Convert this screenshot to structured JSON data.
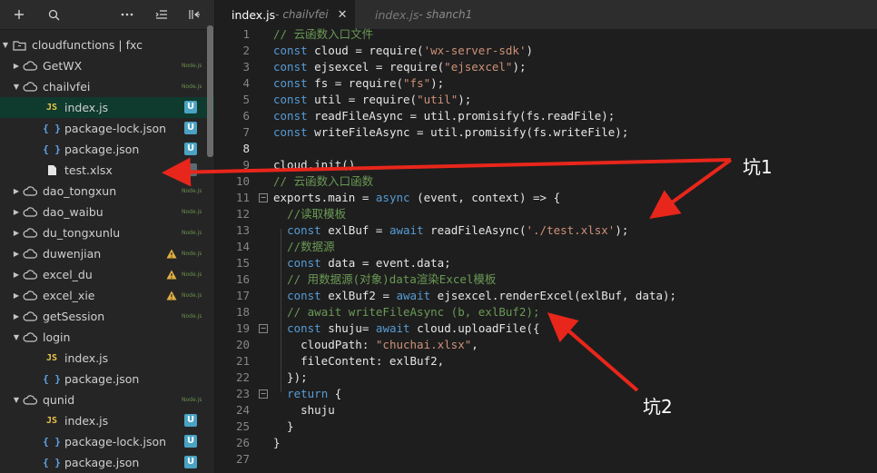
{
  "sidebar": {
    "toolbar_icons": [
      "plus-icon",
      "search-icon",
      "more-icon",
      "collapse-icon",
      "split-icon"
    ],
    "tree": [
      {
        "label": "cloudfunctions | fxc",
        "level": 0,
        "kind": "folder",
        "expanded": true,
        "root": true
      },
      {
        "label": "GetWX",
        "level": 1,
        "kind": "cloud",
        "expanded": false,
        "tag": "Node.js"
      },
      {
        "label": "chailvfei",
        "level": 1,
        "kind": "cloud",
        "expanded": true,
        "tag": "Node.js"
      },
      {
        "label": "index.js",
        "level": 2,
        "kind": "js",
        "badge": "U",
        "active": true
      },
      {
        "label": "package-lock.json",
        "level": 2,
        "kind": "json",
        "badge": "U"
      },
      {
        "label": "package.json",
        "level": 2,
        "kind": "json",
        "badge": "U"
      },
      {
        "label": "test.xlsx",
        "level": 2,
        "kind": "file",
        "badge": ""
      },
      {
        "label": "dao_tongxun",
        "level": 1,
        "kind": "cloud",
        "expanded": false,
        "tag": "Node.js"
      },
      {
        "label": "dao_waibu",
        "level": 1,
        "kind": "cloud",
        "expanded": false,
        "tag": "Node.js"
      },
      {
        "label": "du_tongxunlu",
        "level": 1,
        "kind": "cloud",
        "expanded": false,
        "tag": "Node.js"
      },
      {
        "label": "duwenjian",
        "level": 1,
        "kind": "cloud",
        "expanded": false,
        "tag": "Node.js",
        "warn": true
      },
      {
        "label": "excel_du",
        "level": 1,
        "kind": "cloud",
        "expanded": false,
        "tag": "Node.js",
        "warn": true
      },
      {
        "label": "excel_xie",
        "level": 1,
        "kind": "cloud",
        "expanded": false,
        "tag": "Node.js",
        "warn": true
      },
      {
        "label": "getSession",
        "level": 1,
        "kind": "cloud",
        "expanded": false,
        "tag": "Node.js"
      },
      {
        "label": "login",
        "level": 1,
        "kind": "cloud",
        "expanded": true
      },
      {
        "label": "index.js",
        "level": 2,
        "kind": "js"
      },
      {
        "label": "package.json",
        "level": 2,
        "kind": "json"
      },
      {
        "label": "qunid",
        "level": 1,
        "kind": "cloud",
        "expanded": true,
        "tag": "Node.js"
      },
      {
        "label": "index.js",
        "level": 2,
        "kind": "js",
        "badge": "U"
      },
      {
        "label": "package-lock.json",
        "level": 2,
        "kind": "json",
        "badge": "U"
      },
      {
        "label": "package.json",
        "level": 2,
        "kind": "json",
        "badge": "U"
      }
    ]
  },
  "tabs": [
    {
      "name": "index.js",
      "folder": "chailvfei",
      "active": true,
      "close": "✕"
    },
    {
      "name": "index.js",
      "folder": "shanch1",
      "active": false
    }
  ],
  "code": [
    [
      [
        "cm",
        "// 云函数入口文件"
      ]
    ],
    [
      [
        "kw",
        "const"
      ],
      [
        "",
        "cloud = require("
      ],
      [
        "str",
        "'wx-server-sdk'"
      ],
      [
        "",
        ")"
      ]
    ],
    [
      [
        "kw",
        "const"
      ],
      [
        "",
        "ejsexcel = require("
      ],
      [
        "str",
        "\"ejsexcel\""
      ],
      [
        "",
        ");"
      ]
    ],
    [
      [
        "kw",
        "const"
      ],
      [
        "",
        "fs = require("
      ],
      [
        "str",
        "\"fs\""
      ],
      [
        "",
        ");"
      ]
    ],
    [
      [
        "kw",
        "const"
      ],
      [
        "",
        "util = require("
      ],
      [
        "str",
        "\"util\""
      ],
      [
        "",
        ");"
      ]
    ],
    [
      [
        "kw",
        "const"
      ],
      [
        "",
        "readFileAsync = util.promisify(fs.readFile);"
      ]
    ],
    [
      [
        "kw",
        "const"
      ],
      [
        "",
        "writeFileAsync = util.promisify(fs.writeFile);"
      ]
    ],
    [],
    [
      [
        "",
        "cloud.init()"
      ]
    ],
    [
      [
        "cm",
        "// 云函数入口函数"
      ]
    ],
    [
      [
        "",
        "exports.main = "
      ],
      [
        "kw",
        "async"
      ],
      [
        "",
        "(event, context) => {"
      ]
    ],
    [
      [
        "",
        "  "
      ],
      [
        "cm",
        "//读取模板"
      ]
    ],
    [
      [
        "",
        "  "
      ],
      [
        "kw",
        "const"
      ],
      [
        "",
        "exlBuf = "
      ],
      [
        "kw",
        "await"
      ],
      [
        "",
        "readFileAsync("
      ],
      [
        "str",
        "'./test.xlsx'"
      ],
      [
        "",
        ");"
      ]
    ],
    [
      [
        "",
        "  "
      ],
      [
        "cm",
        "//数据源"
      ]
    ],
    [
      [
        "",
        "  "
      ],
      [
        "kw",
        "const"
      ],
      [
        "",
        "data = event.data;"
      ]
    ],
    [
      [
        "",
        "  "
      ],
      [
        "cm",
        "// 用数据源(对象)data渲染Excel模板"
      ]
    ],
    [
      [
        "",
        "  "
      ],
      [
        "kw",
        "const"
      ],
      [
        "",
        "exlBuf2 = "
      ],
      [
        "kw",
        "await"
      ],
      [
        "",
        "ejsexcel.renderExcel(exlBuf, data);"
      ]
    ],
    [
      [
        "",
        "  "
      ],
      [
        "cm",
        "// await writeFileAsync (b, exlBuf2);"
      ]
    ],
    [
      [
        "",
        "  "
      ],
      [
        "kw",
        "const"
      ],
      [
        "",
        "shuju= "
      ],
      [
        "kw",
        "await"
      ],
      [
        "",
        "cloud.uploadFile({"
      ]
    ],
    [
      [
        "",
        "    cloudPath: "
      ],
      [
        "str",
        "\"chuchai.xlsx\""
      ],
      [
        "",
        ","
      ]
    ],
    [
      [
        "",
        "    fileContent: exlBuf2,"
      ]
    ],
    [
      [
        "",
        "  });"
      ]
    ],
    [
      [
        "",
        "  "
      ],
      [
        "kw",
        "return"
      ],
      [
        "",
        "{"
      ]
    ],
    [
      [
        "",
        "    shuju"
      ]
    ],
    [
      [
        "",
        "  }"
      ]
    ],
    [
      [
        "",
        "}"
      ]
    ],
    []
  ],
  "current_line": 8,
  "fold_lines": [
    11,
    19,
    23
  ],
  "annotations": [
    {
      "text": "坑1"
    },
    {
      "text": "坑2"
    }
  ],
  "colors": {
    "arrow": "#e8261b",
    "keyword": "#569cd6",
    "string": "#ce9178",
    "comment": "#6a9955",
    "badge": "#4aa3c3"
  }
}
